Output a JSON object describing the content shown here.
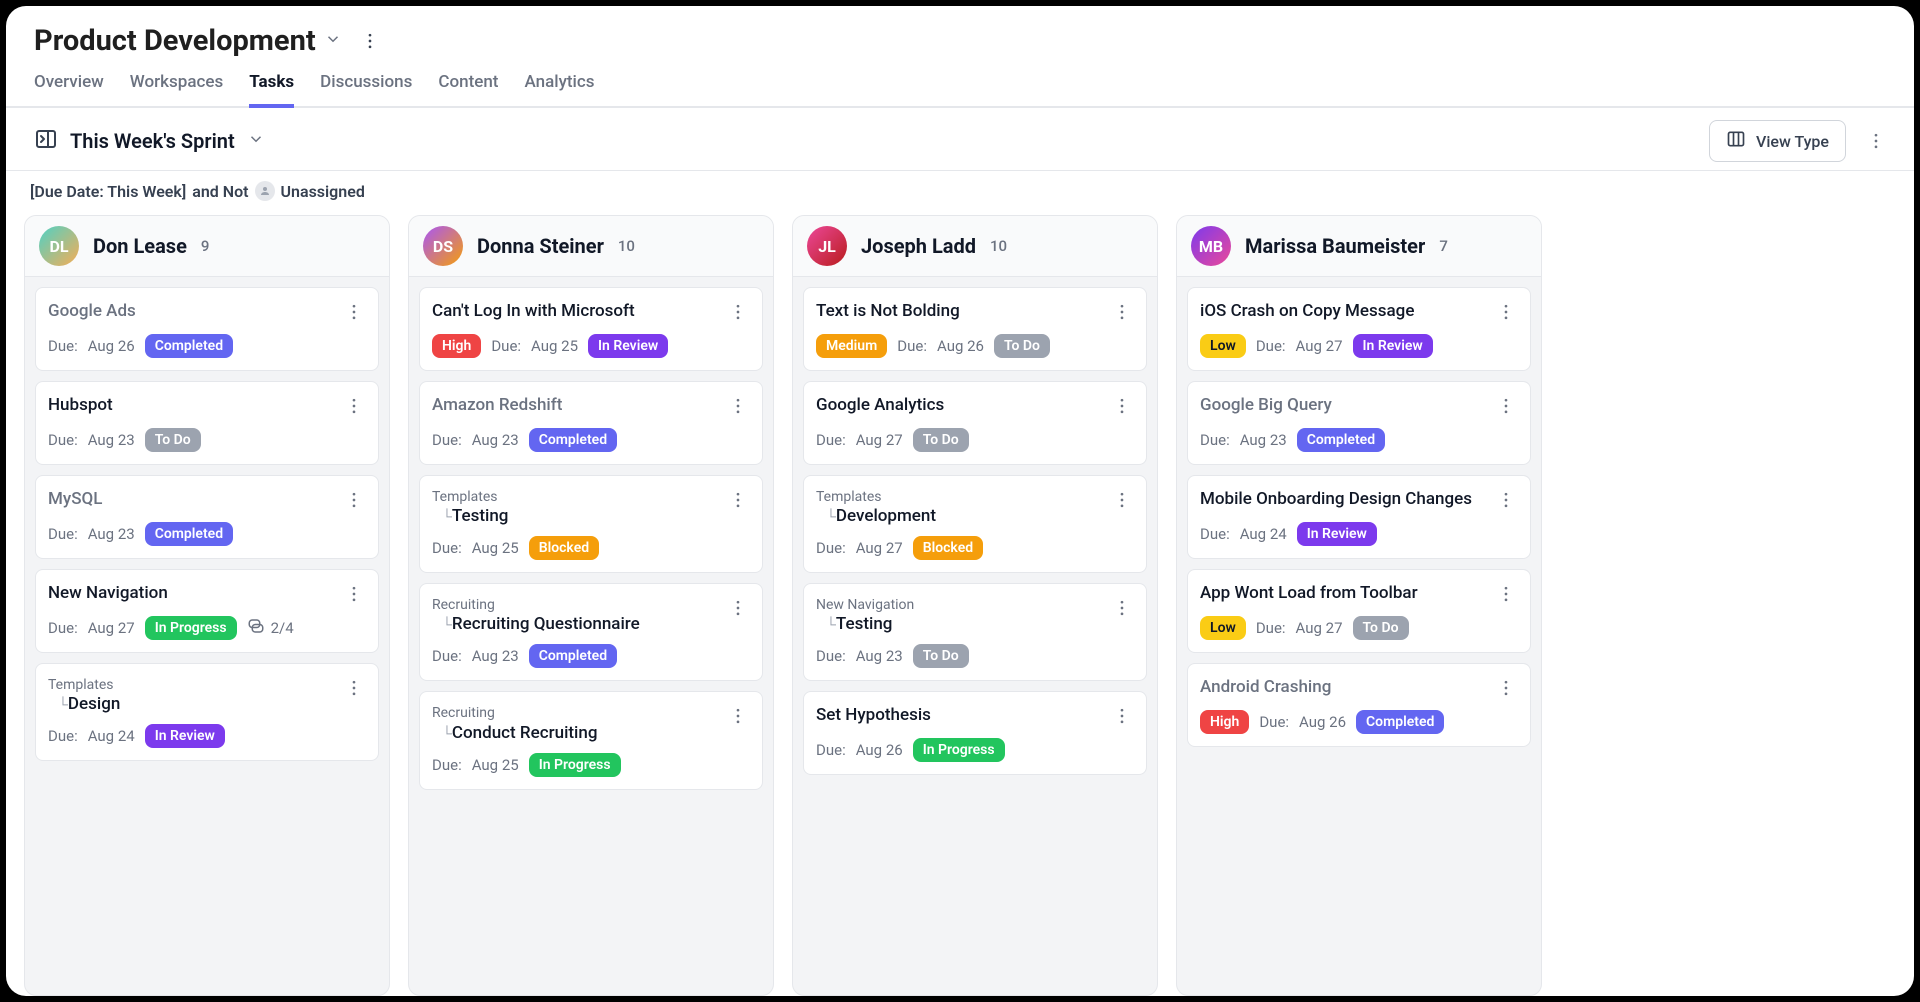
{
  "header": {
    "title": "Product Development"
  },
  "nav": {
    "tabs": [
      "Overview",
      "Workspaces",
      "Tasks",
      "Discussions",
      "Content",
      "Analytics"
    ],
    "active_index": 2
  },
  "subheader": {
    "title": "This Week's Sprint",
    "view_type_label": "View Type"
  },
  "filter": {
    "due_pill": "Due Date: This Week",
    "connector": "and Not",
    "unassigned_text": "Unassigned"
  },
  "labels": {
    "due": "Due:"
  },
  "status_labels": {
    "b-completed": "Completed",
    "b-todo": "To Do",
    "b-inprogress": "In Progress",
    "b-inreview": "In Review",
    "b-blocked": "Blocked"
  },
  "priority_labels": {
    "b-high": "High",
    "b-medium": "Medium",
    "b-low": "Low"
  },
  "columns": [
    {
      "name": "Don Lease",
      "count": 9,
      "avatar_initials": "DL",
      "avatar_class": "av-1",
      "cards": [
        {
          "title": "Google Ads",
          "muted": true,
          "due": "Aug 26",
          "status": "b-completed"
        },
        {
          "title": "Hubspot",
          "due": "Aug 23",
          "status": "b-todo"
        },
        {
          "title": "MySQL",
          "muted": true,
          "due": "Aug 23",
          "status": "b-completed"
        },
        {
          "title": "New Navigation",
          "due": "Aug 27",
          "status": "b-inprogress",
          "subtasks": "2/4"
        },
        {
          "parent": "Templates",
          "title": "Design",
          "due": "Aug 24",
          "status": "b-inreview"
        }
      ]
    },
    {
      "name": "Donna Steiner",
      "count": 10,
      "avatar_initials": "DS",
      "avatar_class": "av-2",
      "cards": [
        {
          "title": "Can't Log In with Microsoft",
          "priority": "b-high",
          "due": "Aug 25",
          "status": "b-inreview"
        },
        {
          "title": "Amazon Redshift",
          "muted": true,
          "due": "Aug 23",
          "status": "b-completed"
        },
        {
          "parent": "Templates",
          "title": "Testing",
          "due": "Aug 25",
          "status": "b-blocked"
        },
        {
          "parent": "Recruiting",
          "title": "Recruiting Questionnaire",
          "due": "Aug 23",
          "status": "b-completed"
        },
        {
          "parent": "Recruiting",
          "title": "Conduct Recruiting",
          "due": "Aug 25",
          "status": "b-inprogress"
        }
      ]
    },
    {
      "name": "Joseph Ladd",
      "count": 10,
      "avatar_initials": "JL",
      "avatar_class": "av-3",
      "cards": [
        {
          "title": "Text is Not Bolding",
          "priority": "b-medium",
          "due": "Aug 26",
          "status": "b-todo"
        },
        {
          "title": "Google Analytics",
          "due": "Aug 27",
          "status": "b-todo"
        },
        {
          "parent": "Templates",
          "title": "Development",
          "due": "Aug 27",
          "status": "b-blocked"
        },
        {
          "parent": "New Navigation",
          "title": "Testing",
          "due": "Aug 23",
          "status": "b-todo"
        },
        {
          "title": "Set Hypothesis",
          "due": "Aug 26",
          "status": "b-inprogress"
        }
      ]
    },
    {
      "name": "Marissa Baumeister",
      "count": 7,
      "avatar_initials": "MB",
      "avatar_class": "av-4",
      "cards": [
        {
          "title": "iOS Crash on Copy Message",
          "priority": "b-low",
          "due": "Aug 27",
          "status": "b-inreview"
        },
        {
          "title": "Google Big Query",
          "muted": true,
          "due": "Aug 23",
          "status": "b-completed"
        },
        {
          "title": "Mobile Onboarding Design Changes",
          "due": "Aug 24",
          "status": "b-inreview"
        },
        {
          "title": "App Wont Load from Toolbar",
          "priority": "b-low",
          "due": "Aug 27",
          "status": "b-todo"
        },
        {
          "title": "Android Crashing",
          "muted": true,
          "priority": "b-high",
          "due": "Aug 26",
          "status": "b-completed"
        }
      ]
    }
  ]
}
